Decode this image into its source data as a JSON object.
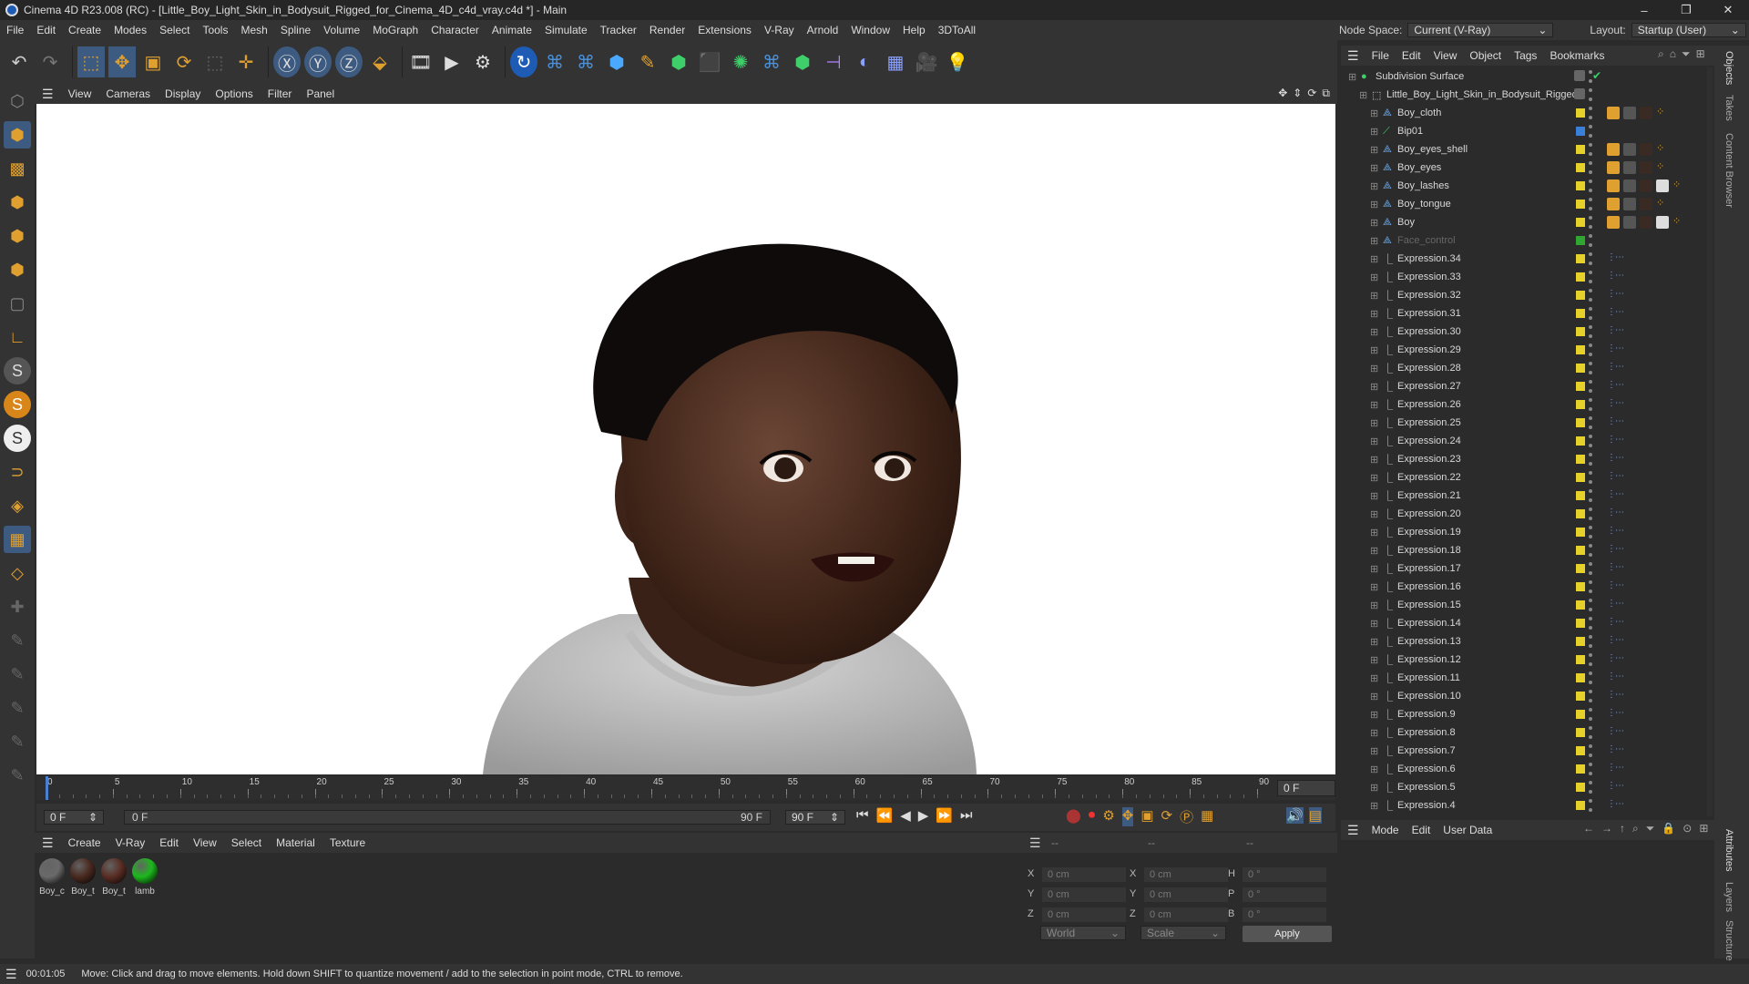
{
  "window": {
    "title": "Cinema 4D R23.008 (RC) - [Little_Boy_Light_Skin_in_Bodysuit_Rigged_for_Cinema_4D_c4d_vray.c4d *] - Main",
    "controls": [
      "–",
      "❐",
      "✕"
    ]
  },
  "menubar": {
    "items": [
      "File",
      "Edit",
      "Create",
      "Modes",
      "Select",
      "Tools",
      "Mesh",
      "Spline",
      "Volume",
      "MoGraph",
      "Character",
      "Animate",
      "Simulate",
      "Tracker",
      "Render",
      "Extensions",
      "V-Ray",
      "Arnold",
      "Window",
      "Help",
      "3DToAll"
    ]
  },
  "nodespace": {
    "label": "Node Space:",
    "value": "Current (V-Ray)",
    "layout_label": "Layout:",
    "layout_value": "Startup (User)"
  },
  "viewport": {
    "menu": [
      "View",
      "Cameras",
      "Display",
      "Options",
      "Filter",
      "Panel"
    ]
  },
  "timeline": {
    "ticks": [
      "0",
      "5",
      "10",
      "15",
      "20",
      "25",
      "30",
      "35",
      "40",
      "45",
      "50",
      "55",
      "60",
      "65",
      "70",
      "75",
      "80",
      "85",
      "90"
    ],
    "current_frame": "0 F",
    "start_field": "0 F",
    "range_start": "0 F",
    "range_end": "90 F",
    "end_field": "90 F"
  },
  "material_manager": {
    "menu": [
      "Create",
      "V-Ray",
      "Edit",
      "View",
      "Select",
      "Material",
      "Texture"
    ],
    "materials": [
      {
        "label": "Boy_c",
        "color": "#6a6a6a"
      },
      {
        "label": "Boy_t",
        "color": "#4a2a20"
      },
      {
        "label": "Boy_t",
        "color": "#5a2e24"
      },
      {
        "label": "lamb",
        "color": "#1db81d"
      }
    ]
  },
  "coordinates": {
    "header": "--",
    "col2": "--",
    "col3": "--",
    "pos": [
      {
        "axis": "X",
        "value": "0 cm"
      },
      {
        "axis": "Y",
        "value": "0 cm"
      },
      {
        "axis": "Z",
        "value": "0 cm"
      }
    ],
    "size": [
      {
        "axis": "X",
        "value": "0 cm"
      },
      {
        "axis": "Y",
        "value": "0 cm"
      },
      {
        "axis": "Z",
        "value": "0 cm"
      }
    ],
    "rot": [
      {
        "axis": "H",
        "value": "0 °"
      },
      {
        "axis": "P",
        "value": "0 °"
      },
      {
        "axis": "B",
        "value": "0 °"
      }
    ],
    "world": "World",
    "scale": "Scale",
    "apply": "Apply"
  },
  "status": {
    "time": "00:01:05",
    "message": "Move: Click and drag to move elements. Hold down SHIFT to quantize movement / add to the selection in point mode, CTRL to remove."
  },
  "object_manager": {
    "menu": [
      "File",
      "Edit",
      "View",
      "Object",
      "Tags",
      "Bookmarks"
    ],
    "objects": [
      {
        "name": "Subdivision Surface",
        "indent": 0,
        "color": "",
        "dim": false,
        "tags": "check"
      },
      {
        "name": "Little_Boy_Light_Skin_in_Bodysuit_Rigged",
        "indent": 1,
        "color": "",
        "dim": false,
        "tags": ""
      },
      {
        "name": "Boy_cloth",
        "indent": 2,
        "color": "yellow",
        "dim": false,
        "tags": "mat3"
      },
      {
        "name": "Bip01",
        "indent": 2,
        "color": "blue",
        "dim": false,
        "tags": ""
      },
      {
        "name": "Boy_eyes_shell",
        "indent": 2,
        "color": "yellow",
        "dim": false,
        "tags": "mat3"
      },
      {
        "name": "Boy_eyes",
        "indent": 2,
        "color": "yellow",
        "dim": false,
        "tags": "mat3"
      },
      {
        "name": "Boy_lashes",
        "indent": 2,
        "color": "yellow",
        "dim": false,
        "tags": "mat4"
      },
      {
        "name": "Boy_tongue",
        "indent": 2,
        "color": "yellow",
        "dim": false,
        "tags": "mat3"
      },
      {
        "name": "Boy",
        "indent": 2,
        "color": "yellow",
        "dim": false,
        "tags": "mat4"
      },
      {
        "name": "Face_control",
        "indent": 2,
        "color": "green",
        "dim": true,
        "tags": ""
      },
      {
        "name": "Expression.34",
        "indent": 2,
        "color": "yellow",
        "dim": false,
        "tags": "ex"
      },
      {
        "name": "Expression.33",
        "indent": 2,
        "color": "yellow",
        "dim": false,
        "tags": "ex"
      },
      {
        "name": "Expression.32",
        "indent": 2,
        "color": "yellow",
        "dim": false,
        "tags": "ex"
      },
      {
        "name": "Expression.31",
        "indent": 2,
        "color": "yellow",
        "dim": false,
        "tags": "ex"
      },
      {
        "name": "Expression.30",
        "indent": 2,
        "color": "yellow",
        "dim": false,
        "tags": "ex"
      },
      {
        "name": "Expression.29",
        "indent": 2,
        "color": "yellow",
        "dim": false,
        "tags": "ex"
      },
      {
        "name": "Expression.28",
        "indent": 2,
        "color": "yellow",
        "dim": false,
        "tags": "ex"
      },
      {
        "name": "Expression.27",
        "indent": 2,
        "color": "yellow",
        "dim": false,
        "tags": "ex"
      },
      {
        "name": "Expression.26",
        "indent": 2,
        "color": "yellow",
        "dim": false,
        "tags": "ex"
      },
      {
        "name": "Expression.25",
        "indent": 2,
        "color": "yellow",
        "dim": false,
        "tags": "ex"
      },
      {
        "name": "Expression.24",
        "indent": 2,
        "color": "yellow",
        "dim": false,
        "tags": "ex"
      },
      {
        "name": "Expression.23",
        "indent": 2,
        "color": "yellow",
        "dim": false,
        "tags": "ex"
      },
      {
        "name": "Expression.22",
        "indent": 2,
        "color": "yellow",
        "dim": false,
        "tags": "ex"
      },
      {
        "name": "Expression.21",
        "indent": 2,
        "color": "yellow",
        "dim": false,
        "tags": "ex"
      },
      {
        "name": "Expression.20",
        "indent": 2,
        "color": "yellow",
        "dim": false,
        "tags": "ex"
      },
      {
        "name": "Expression.19",
        "indent": 2,
        "color": "yellow",
        "dim": false,
        "tags": "ex"
      },
      {
        "name": "Expression.18",
        "indent": 2,
        "color": "yellow",
        "dim": false,
        "tags": "ex"
      },
      {
        "name": "Expression.17",
        "indent": 2,
        "color": "yellow",
        "dim": false,
        "tags": "ex"
      },
      {
        "name": "Expression.16",
        "indent": 2,
        "color": "yellow",
        "dim": false,
        "tags": "ex"
      },
      {
        "name": "Expression.15",
        "indent": 2,
        "color": "yellow",
        "dim": false,
        "tags": "ex"
      },
      {
        "name": "Expression.14",
        "indent": 2,
        "color": "yellow",
        "dim": false,
        "tags": "ex"
      },
      {
        "name": "Expression.13",
        "indent": 2,
        "color": "yellow",
        "dim": false,
        "tags": "ex"
      },
      {
        "name": "Expression.12",
        "indent": 2,
        "color": "yellow",
        "dim": false,
        "tags": "ex"
      },
      {
        "name": "Expression.11",
        "indent": 2,
        "color": "yellow",
        "dim": false,
        "tags": "ex"
      },
      {
        "name": "Expression.10",
        "indent": 2,
        "color": "yellow",
        "dim": false,
        "tags": "ex"
      },
      {
        "name": "Expression.9",
        "indent": 2,
        "color": "yellow",
        "dim": false,
        "tags": "ex"
      },
      {
        "name": "Expression.8",
        "indent": 2,
        "color": "yellow",
        "dim": false,
        "tags": "ex"
      },
      {
        "name": "Expression.7",
        "indent": 2,
        "color": "yellow",
        "dim": false,
        "tags": "ex"
      },
      {
        "name": "Expression.6",
        "indent": 2,
        "color": "yellow",
        "dim": false,
        "tags": "ex"
      },
      {
        "name": "Expression.5",
        "indent": 2,
        "color": "yellow",
        "dim": false,
        "tags": "ex"
      },
      {
        "name": "Expression.4",
        "indent": 2,
        "color": "yellow",
        "dim": false,
        "tags": "ex"
      }
    ]
  },
  "attribute_manager": {
    "menu": [
      "Mode",
      "Edit",
      "User Data"
    ]
  },
  "side_tabs": [
    "Objects",
    "Takes",
    "Content Browser",
    "Attributes",
    "Layers",
    "Structure"
  ]
}
